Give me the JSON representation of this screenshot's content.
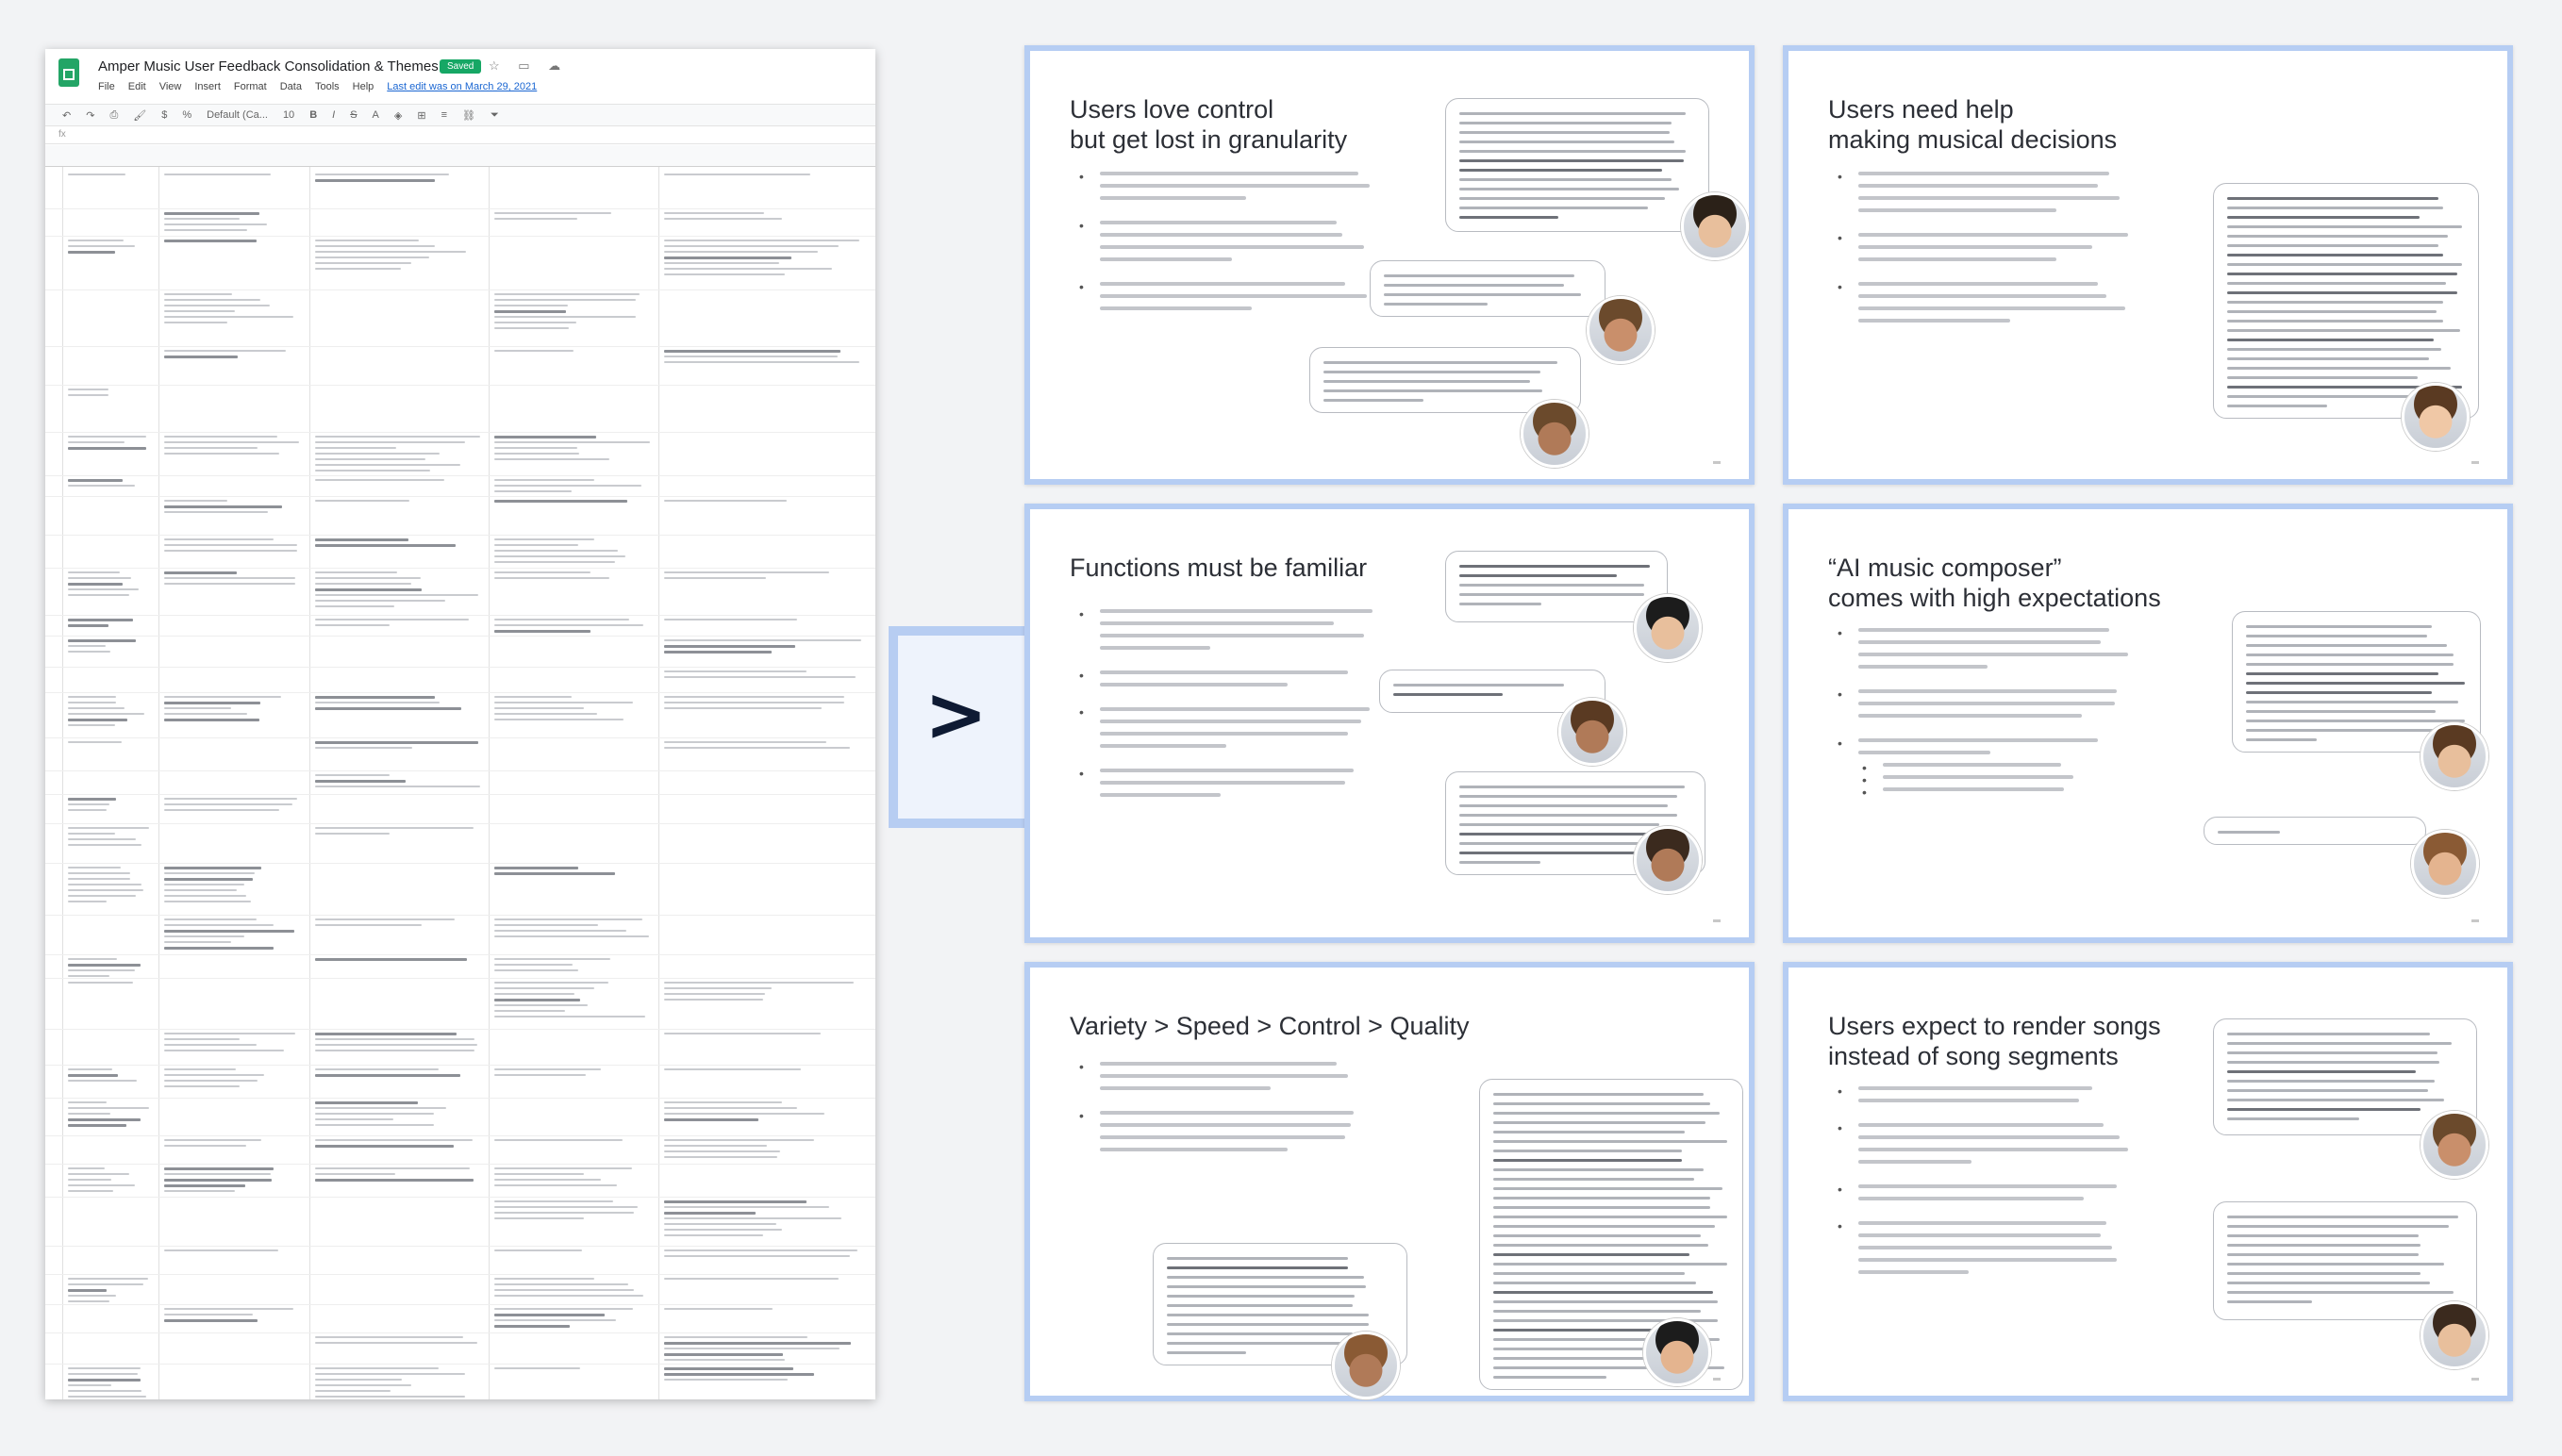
{
  "spreadsheet": {
    "title": "Amper Music User Feedback Consolidation & Themes",
    "saved_badge": "Saved",
    "menu": [
      "File",
      "Edit",
      "View",
      "Insert",
      "Format",
      "Data",
      "Tools",
      "Help"
    ],
    "last_edit": "Last edit was on March 29, 2021",
    "toolbar_font": "Default (Ca...",
    "toolbar_size": "10"
  },
  "arrow": {
    "glyph": ">"
  },
  "slides": [
    {
      "title": "Users love control\nbut get lost in granularity"
    },
    {
      "title": "Users need help\nmaking musical decisions"
    },
    {
      "title": "Functions must be familiar"
    },
    {
      "title": "“AI music composer”\ncomes with high expectations"
    },
    {
      "title": "Variety > Speed > Control > Quality"
    },
    {
      "title": "Users expect to render songs\ninstead of song segments"
    }
  ],
  "colors": {
    "slide_border": "#b6cdf3",
    "sheets_green": "#23a566",
    "arrow_dark": "#0e1a33"
  }
}
